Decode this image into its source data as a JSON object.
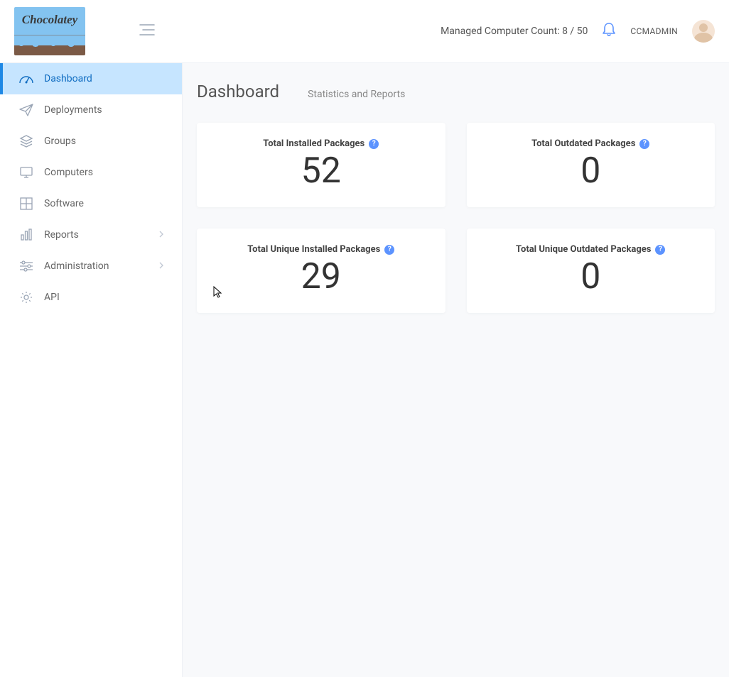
{
  "header": {
    "logo_text": "Chocolatey",
    "computer_count_text": "Managed Computer Count: 8 / 50",
    "username": "CCMADMIN"
  },
  "sidebar": {
    "items": [
      {
        "label": "Dashboard"
      },
      {
        "label": "Deployments"
      },
      {
        "label": "Groups"
      },
      {
        "label": "Computers"
      },
      {
        "label": "Software"
      },
      {
        "label": "Reports"
      },
      {
        "label": "Administration"
      },
      {
        "label": "API"
      }
    ]
  },
  "main": {
    "title": "Dashboard",
    "subtitle": "Statistics and Reports",
    "cards": [
      {
        "title": "Total Installed Packages",
        "value": "52"
      },
      {
        "title": "Total Outdated Packages",
        "value": "0"
      },
      {
        "title": "Total Unique Installed Packages",
        "value": "29"
      },
      {
        "title": "Total Unique Outdated Packages",
        "value": "0"
      }
    ]
  }
}
